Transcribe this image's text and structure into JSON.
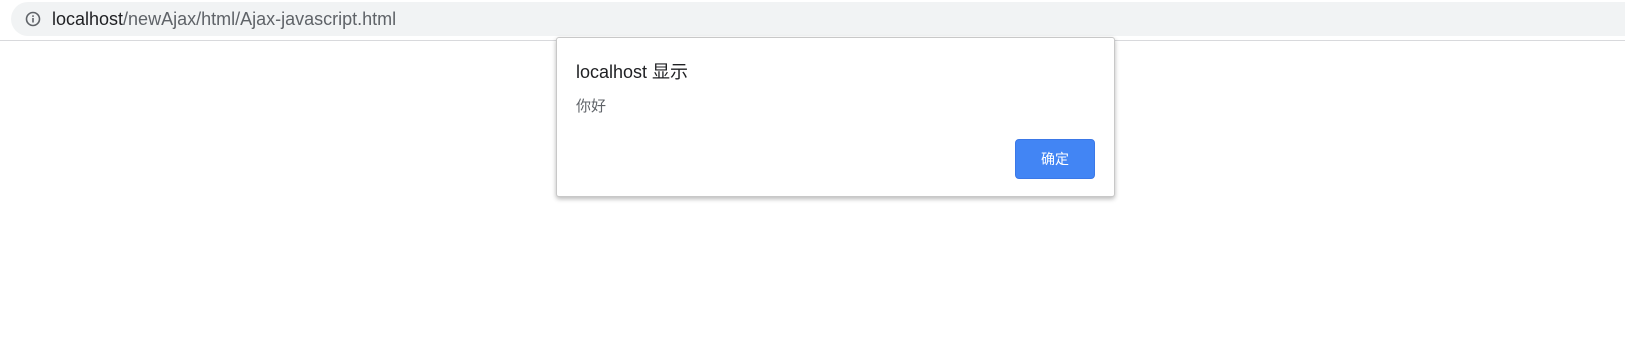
{
  "browser": {
    "url_host": "localhost",
    "url_path": "/newAjax/html/Ajax-javascript.html",
    "info_icon": "info-icon"
  },
  "dialog": {
    "title": "localhost 显示",
    "message": "你好",
    "ok_label": "确定"
  },
  "colors": {
    "accent": "#4285f4",
    "omnibox_bg": "#f1f3f4",
    "text_primary": "#202124",
    "text_secondary": "#5f6368"
  }
}
